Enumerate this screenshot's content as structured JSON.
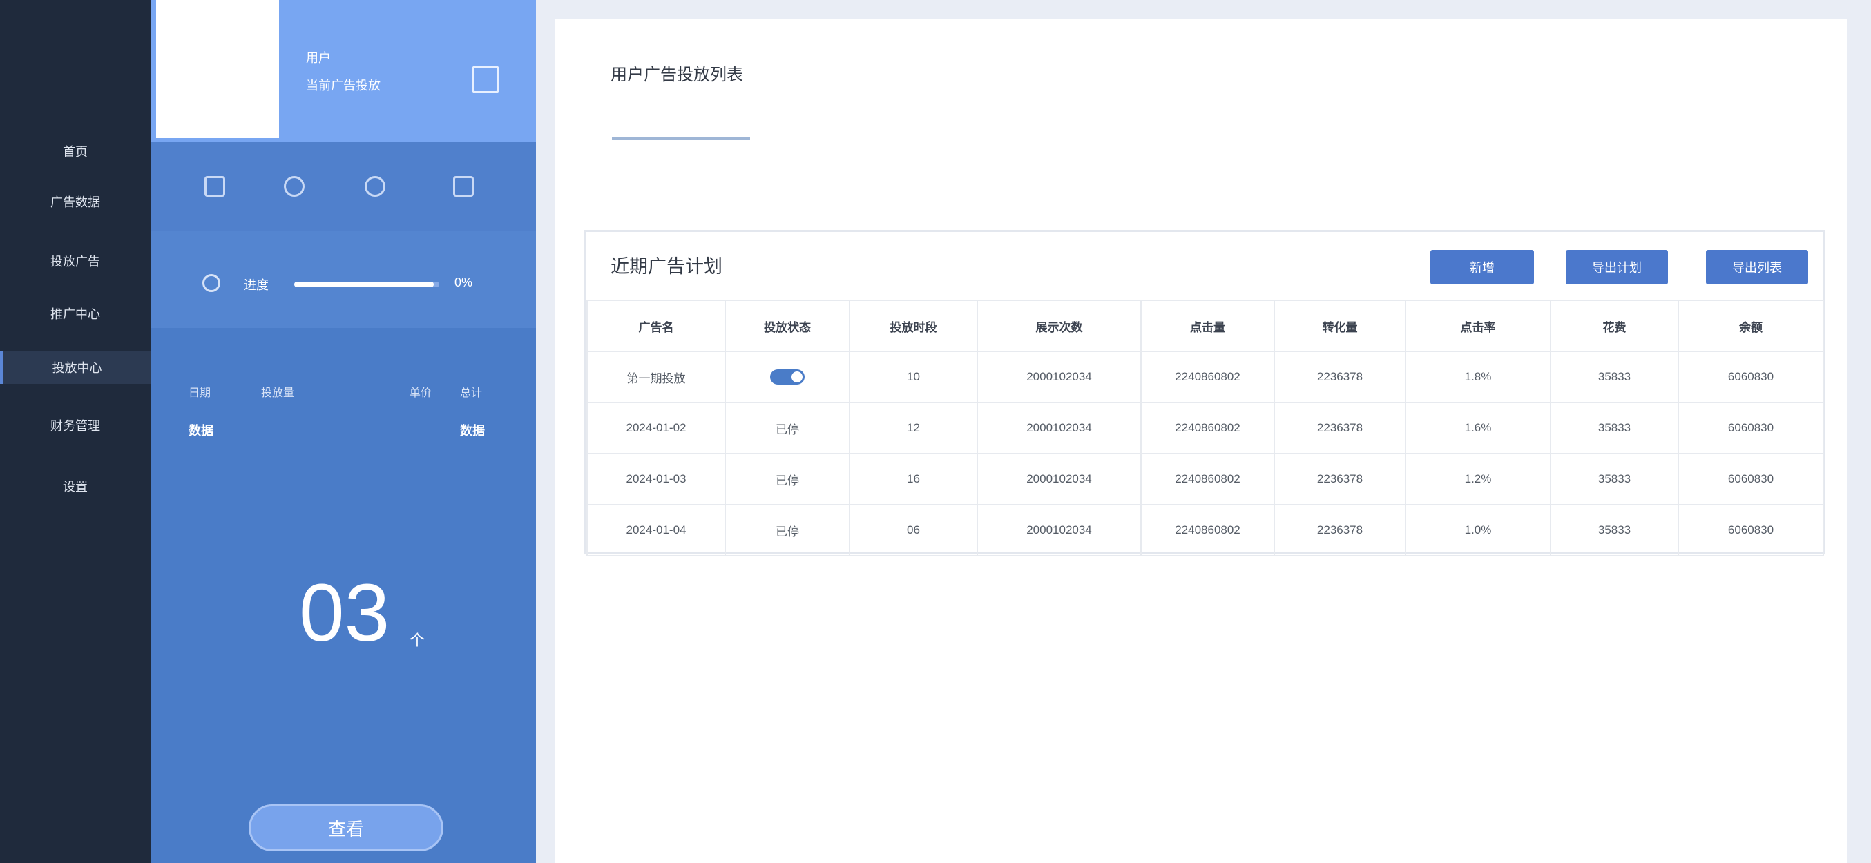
{
  "sidebar": {
    "items": [
      {
        "label": "首页",
        "active": false
      },
      {
        "label": "广告数据",
        "active": false
      },
      {
        "label": "投放广告",
        "active": false
      },
      {
        "label": "推广中心",
        "active": false
      },
      {
        "label": "投放中心",
        "active": true
      },
      {
        "label": "财务管理",
        "active": false
      },
      {
        "label": "设置",
        "active": false
      }
    ]
  },
  "user_panel": {
    "name": "用户",
    "subtitle": "当前广告投放",
    "exit_icon": "exit-icon",
    "tool_icons": [
      "calendar-icon",
      "user-icon",
      "settings-icon",
      "chat-icon"
    ],
    "progress": {
      "label": "进度",
      "value_text": "0%",
      "fraction": 0.96
    },
    "stats": {
      "headers": [
        "日期",
        "投放量",
        "单价",
        "总计"
      ],
      "values": [
        "数据",
        "数据"
      ]
    },
    "big_number": "03",
    "big_unit": "个",
    "button_label": "查看"
  },
  "main": {
    "tab_label": "用户广告投放列表",
    "card_title": "近期广告计划",
    "buttons": [
      "新增",
      "导出计划",
      "导出列表"
    ],
    "table": {
      "headers": [
        "广告名",
        "投放状态",
        "投放时段",
        "展示次数",
        "点击量",
        "转化量",
        "点击率",
        "花费",
        "余额"
      ],
      "rows": [
        {
          "cells": [
            "第一期投放",
            "",
            "10",
            "2000102034",
            "2240860802",
            "2236378",
            "1.8%",
            "35833",
            "6060830"
          ],
          "status_toggle": true
        },
        {
          "cells": [
            "2024-01-02",
            "已停",
            "12",
            "2000102034",
            "2240860802",
            "2236378",
            "1.6%",
            "35833",
            "6060830"
          ],
          "status_toggle": false
        },
        {
          "cells": [
            "2024-01-03",
            "已停",
            "16",
            "2000102034",
            "2240860802",
            "2236378",
            "1.2%",
            "35833",
            "6060830"
          ],
          "status_toggle": false
        },
        {
          "cells": [
            "2024-01-04",
            "已停",
            "06",
            "2000102034",
            "2240860802",
            "2236378",
            "1.0%",
            "35833",
            "6060830"
          ],
          "status_toggle": false
        }
      ]
    }
  },
  "colors": {
    "sidebar_bg": "#1f2a3c",
    "panel_bg": "#4a7cc8",
    "accent": "#4b78cc",
    "panel_top": "#78a6f2"
  }
}
